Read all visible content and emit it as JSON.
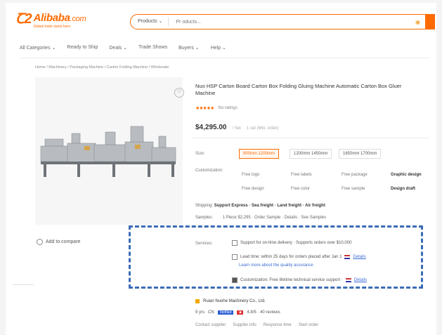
{
  "header": {
    "logo_mark": "Ꞇ2",
    "logo_name": "Alibaba",
    "logo_suffix": ".com",
    "logo_tagline": "Global trade starts here.",
    "search_category": "Products ⌄",
    "search_placeholder": "Pr oducts..."
  },
  "nav": [
    "All Categories ⌄",
    "Ready to Ship",
    "Deals ⌄",
    "Trade Shows",
    "Buyers ⌄",
    "Help ⌄"
  ],
  "breadcrumb": "Home / Machinery / Packaging Machine / Carton Folding Machine  /  Wholesale",
  "product": {
    "compare_label": "Add to compare",
    "title": "Nuo HSP Carton Board Carton Box Folding Gluing Machine Automatic Carton Box Gluer Machine",
    "stars": "★★★★★",
    "rating_text": "No ratings",
    "price": "$4,295.00",
    "price_unit": "/ Set",
    "price_note": "1 set (Min. order)"
  },
  "options": {
    "size_label": "Size:",
    "sizes": [
      "900mm 1200mm",
      "1200mm 1450mm",
      "1650mm 1700mm"
    ],
    "custom_label": "Customization:",
    "custom_row1": [
      "Free logo",
      "Free labels",
      "Free package",
      "Graphic design"
    ],
    "custom_row2": [
      "Free design",
      "Free color",
      "Free sample",
      "Design draft"
    ],
    "service_label": "Shipping:",
    "service_text": "Support Express · Sea freight · Land freight · Air freight",
    "protect_label": "Samples:",
    "protect_text": "1 Piece $2,295 · Order Sample · Details · See Samples"
  },
  "services": {
    "label": "Services:",
    "line1": "Support for on-time delivery · Supports orders over $10,000",
    "line2": "Lead time: within 25 days for orders placed after Jan 1",
    "line2_link": "Details",
    "line3": "Learn more about the quality assurance",
    "line4": "Customization: Free lifetime technical service support ·",
    "line4_link": "Details"
  },
  "supplier": {
    "name": "Ruian Nuohe Machinery Co., Ltd.",
    "years": "9 yrs",
    "country": "CN",
    "badge1": "Verified",
    "rating_text": "4.8/5 · 40 reviews",
    "links": [
      "Contact supplier",
      "Supplier info",
      "Response time",
      "Start order"
    ]
  }
}
